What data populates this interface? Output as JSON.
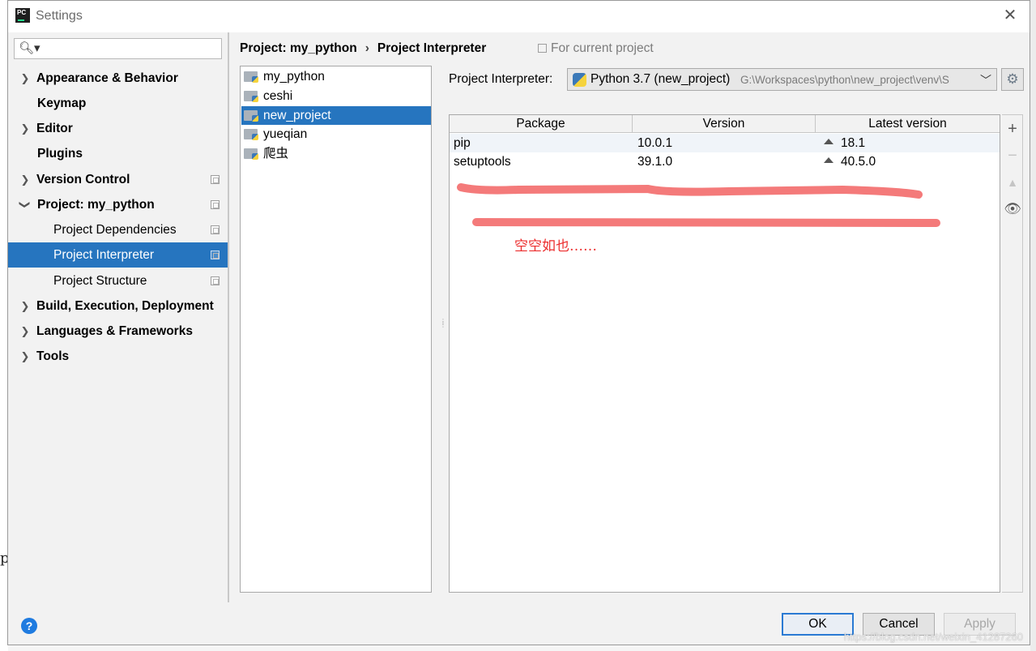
{
  "window": {
    "title": "Settings",
    "icon": "pycharm-icon",
    "close_glyph": "✕"
  },
  "search": {
    "placeholder": "",
    "value": ""
  },
  "sidebar": {
    "items": [
      {
        "label": "Appearance & Behavior",
        "expandable": true
      },
      {
        "label": "Keymap",
        "expandable": false
      },
      {
        "label": "Editor",
        "expandable": true
      },
      {
        "label": "Plugins",
        "expandable": false
      },
      {
        "label": "Version Control",
        "expandable": true
      },
      {
        "label": "Project: my_python",
        "expanded": true
      },
      {
        "label": "Project Dependencies"
      },
      {
        "label": "Project Interpreter",
        "selected": true
      },
      {
        "label": "Project Structure"
      },
      {
        "label": "Build, Execution, Deployment",
        "expandable": true
      },
      {
        "label": "Languages & Frameworks",
        "expandable": true
      },
      {
        "label": "Tools",
        "expandable": true
      }
    ]
  },
  "breadcrumb": {
    "parent": "Project: my_python",
    "sep": "›",
    "current": "Project Interpreter"
  },
  "scope_hint": "For current project",
  "projects": [
    {
      "label": "my_python"
    },
    {
      "label": "ceshi"
    },
    {
      "label": "new_project",
      "selected": true
    },
    {
      "label": "yueqian"
    },
    {
      "label": "爬虫"
    }
  ],
  "interpreter": {
    "label": "Project Interpreter:",
    "name": "Python 3.7 (new_project)",
    "path": "G:\\Workspaces\\python\\new_project\\venv\\S"
  },
  "packages": {
    "headers": [
      "Package",
      "Version",
      "Latest version"
    ],
    "rows": [
      {
        "package": "pip",
        "version": "10.0.1",
        "latest": "18.1"
      },
      {
        "package": "setuptools",
        "version": "39.1.0",
        "latest": "40.5.0"
      }
    ]
  },
  "annotation": "空空如也……",
  "footer": {
    "help": "?",
    "ok": "OK",
    "cancel": "Cancel",
    "apply": "Apply",
    "watermark": "https://blog.csdn.net/weixin_41287260"
  },
  "colors": {
    "selection": "#2675bf",
    "highlight_stroke": "#f47a7a",
    "annotation": "#ec2d2d"
  },
  "background_app": {
    "partial_char": "p"
  }
}
